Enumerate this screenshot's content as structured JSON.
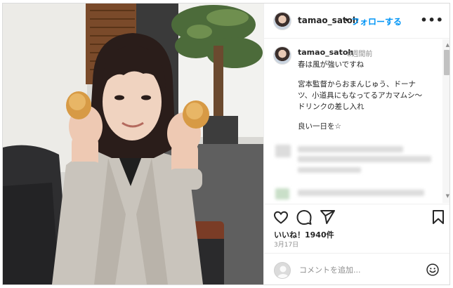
{
  "header": {
    "username": "tamao_satoh",
    "separator": "•",
    "follow_label": "フォローする",
    "more_label": "•••"
  },
  "caption": {
    "username": "tamao_satoh",
    "time": "8週間前",
    "lines": [
      "春は風が強いですね",
      "宮本監督からおまんじゅう、ドーナ",
      "ツ、小道具にもなってるアカマムシ〜",
      "ドリンクの差し入れ",
      "良い一日を☆"
    ]
  },
  "scrollbar": {
    "up": "▲",
    "down": "▼"
  },
  "actions": {
    "icons": [
      "heart-icon",
      "comment-icon",
      "share-icon",
      "bookmark-icon"
    ]
  },
  "likes_text": "いいね！1940件",
  "date_text": "3月17日",
  "composer": {
    "placeholder": "コメントを追加..."
  },
  "colors": {
    "follow": "#0095f6",
    "text": "#262626",
    "muted": "#8e8e8e",
    "border": "#dbdbdb"
  }
}
